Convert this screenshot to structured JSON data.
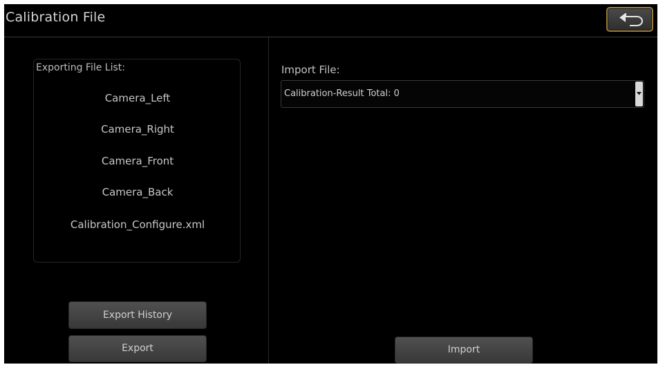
{
  "header": {
    "title": "Calibration File",
    "back_icon": "back-arrow-icon"
  },
  "export_panel": {
    "title": "Exporting File List:",
    "items": [
      "Camera_Left",
      "Camera_Right",
      "Camera_Front",
      "Camera_Back",
      "Calibration_Configure.xml"
    ],
    "export_history_label": "Export History",
    "export_label": "Export"
  },
  "import_panel": {
    "label": "Import File:",
    "select_value": "Calibration-Result Total: 0",
    "select_icon": "dropdown-arrow-icon",
    "import_label": "Import"
  },
  "colors": {
    "background": "#000000",
    "text": "#c8c8c8",
    "back_button_border": "#9a7b3a",
    "button_fill": "#444444"
  }
}
